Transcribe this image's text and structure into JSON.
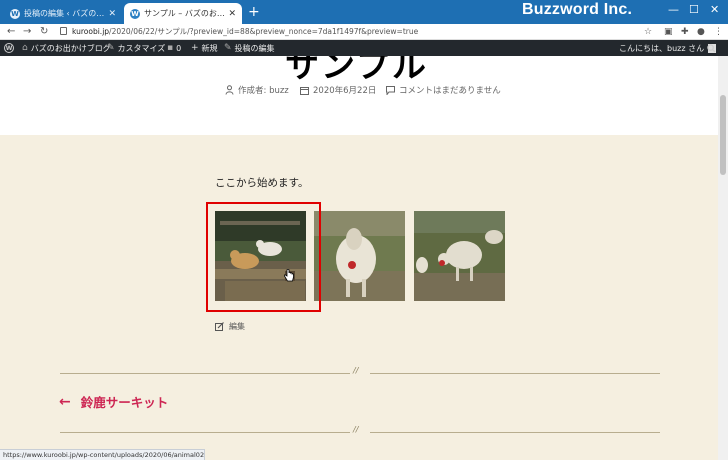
{
  "browser": {
    "tabs": [
      {
        "title": "投稿の編集 ‹ バズのお出かけブログ",
        "active": false
      },
      {
        "title": "サンプル – バズのお出かけブログ",
        "active": true
      }
    ],
    "brand": "Buzzword Inc.",
    "address": {
      "host": "kuroobi.jp",
      "path": "/2020/06/22/サンプル/?preview_id=88&preview_nonce=7da1f1497f&preview=true"
    },
    "status_url": "https://www.kuroobi.jp/wp-content/uploads/2020/06/animal02-scaled.jpg"
  },
  "adminbar": {
    "site_name": "バズのお出かけブログ",
    "customize": "カスタマイズ",
    "comments_count": "0",
    "new_label": "新規",
    "edit_post": "投稿の編集",
    "greeting": "こんにちは、buzz さん"
  },
  "post": {
    "title_fragment": "サンプル",
    "author_label": "作成者: buzz",
    "date": "2020年6月22日",
    "comments": "コメントはまだありません",
    "lead": "ここから始めます。",
    "edit_label": "編集",
    "separator_mark": "//",
    "prev_arrow": "←",
    "prev_title": "鈴鹿サーキット"
  },
  "gallery": {
    "images": [
      "goat-on-fence-photo",
      "sheep-front-photo",
      "sheep-grazing-photo"
    ],
    "selected_index": 0
  },
  "colors": {
    "tab_strip": "#1e6fb3",
    "admin_bar": "#23282d",
    "content_bg": "#f5efe0",
    "accent": "#cd2653",
    "selection": "#e00000"
  }
}
